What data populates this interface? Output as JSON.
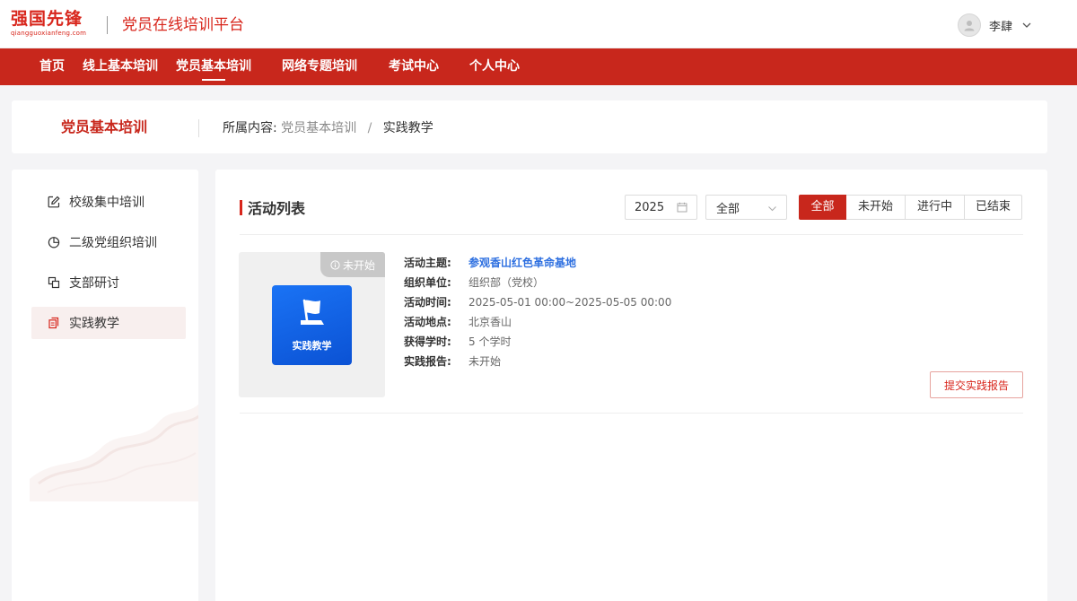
{
  "header": {
    "logo_main": "强国先锋",
    "logo_sub": "qiangguoxianfeng.com",
    "platform_title": "党员在线培训平台",
    "user_name": "李肆"
  },
  "nav": {
    "items": [
      {
        "label": "首页"
      },
      {
        "label": "线上基本培训"
      },
      {
        "label": "党员基本培训",
        "active": true
      },
      {
        "label": "网络专题培训"
      },
      {
        "label": "考试中心"
      },
      {
        "label": "个人中心"
      }
    ]
  },
  "breadcrumb": {
    "section_title": "党员基本培训",
    "prefix": "所属内容:",
    "parent": "党员基本培训",
    "separator": "/",
    "current": "实践教学"
  },
  "sidebar": {
    "items": [
      {
        "label": "校级集中培训",
        "icon": "edit-icon"
      },
      {
        "label": "二级党组织培训",
        "icon": "pie-chart-icon"
      },
      {
        "label": "支部研讨",
        "icon": "copy-icon"
      },
      {
        "label": "实践教学",
        "icon": "document-icon",
        "active": true
      }
    ]
  },
  "main": {
    "list_title": "活动列表",
    "year_value": "2025",
    "select_value": "全部",
    "filters": [
      {
        "label": "全部",
        "active": true
      },
      {
        "label": "未开始"
      },
      {
        "label": "进行中"
      },
      {
        "label": "已结束"
      }
    ]
  },
  "activity": {
    "status_badge": "未开始",
    "thumb_label": "实践教学",
    "fields": [
      {
        "label": "活动主题:",
        "value": "参观香山红色革命基地"
      },
      {
        "label": "组织单位:",
        "value": "组织部（党校）"
      },
      {
        "label": "活动时间:",
        "value": "2025-05-01 00:00~2025-05-05 00:00"
      },
      {
        "label": "活动地点:",
        "value": "北京香山"
      },
      {
        "label": "获得学时:",
        "value": "5 个学时"
      },
      {
        "label": "实践报告:",
        "value": "未开始"
      }
    ],
    "submit_label": "提交实践报告"
  },
  "colors": {
    "brand_red": "#c8271c",
    "link_blue": "#2d6fe0",
    "thumb_blue": "#1a73f5"
  }
}
